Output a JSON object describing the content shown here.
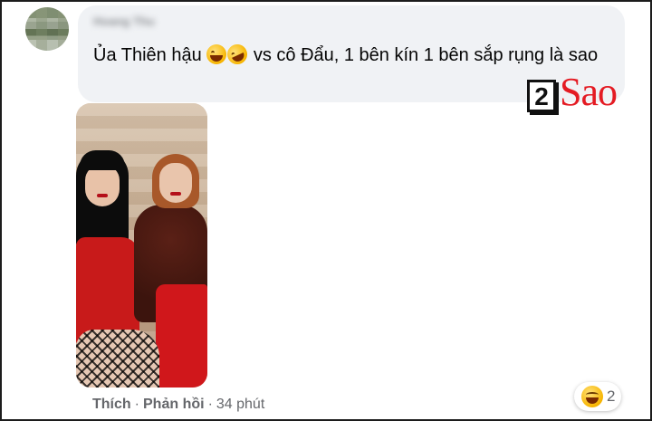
{
  "comment": {
    "author_name": "Hoang Thu",
    "text_before_emoji": "Ủa Thiên hậu ",
    "text_after_emoji": " vs cô Đẩu, 1 bên kín 1 bên sắp rụng là sao",
    "emojis": [
      "laughing-emoji-icon",
      "rolling-laughing-emoji-icon"
    ]
  },
  "watermark": {
    "number": "2",
    "word": "Sao",
    "color": "#e41b23"
  },
  "actions": {
    "like": "Thích",
    "reply": "Phản hồi",
    "separator": "·",
    "time": "34 phút"
  },
  "reactions": {
    "icon": "haha-reaction-icon",
    "count": "2"
  },
  "colors": {
    "bubble": "#f0f2f5",
    "meta_text": "#65676b"
  }
}
